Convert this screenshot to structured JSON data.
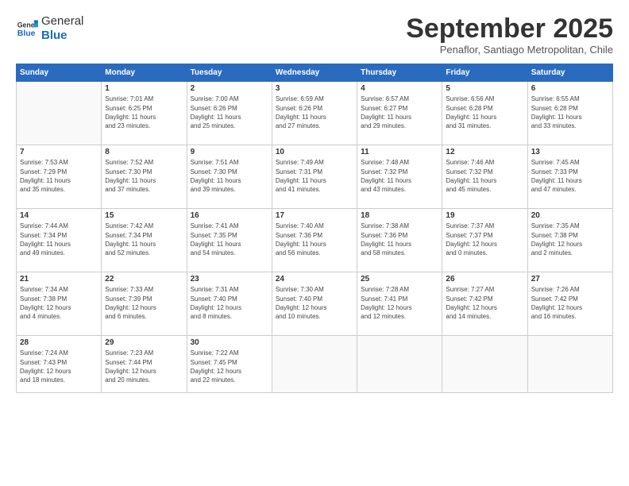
{
  "header": {
    "logo_general": "General",
    "logo_blue": "Blue",
    "month_title": "September 2025",
    "subtitle": "Penaflor, Santiago Metropolitan, Chile"
  },
  "days_of_week": [
    "Sunday",
    "Monday",
    "Tuesday",
    "Wednesday",
    "Thursday",
    "Friday",
    "Saturday"
  ],
  "weeks": [
    [
      {
        "day": "",
        "info": ""
      },
      {
        "day": "1",
        "info": "Sunrise: 7:01 AM\nSunset: 6:25 PM\nDaylight: 11 hours\nand 23 minutes."
      },
      {
        "day": "2",
        "info": "Sunrise: 7:00 AM\nSunset: 6:26 PM\nDaylight: 11 hours\nand 25 minutes."
      },
      {
        "day": "3",
        "info": "Sunrise: 6:59 AM\nSunset: 6:26 PM\nDaylight: 11 hours\nand 27 minutes."
      },
      {
        "day": "4",
        "info": "Sunrise: 6:57 AM\nSunset: 6:27 PM\nDaylight: 11 hours\nand 29 minutes."
      },
      {
        "day": "5",
        "info": "Sunrise: 6:56 AM\nSunset: 6:28 PM\nDaylight: 11 hours\nand 31 minutes."
      },
      {
        "day": "6",
        "info": "Sunrise: 6:55 AM\nSunset: 6:28 PM\nDaylight: 11 hours\nand 33 minutes."
      }
    ],
    [
      {
        "day": "7",
        "info": "Sunrise: 7:53 AM\nSunset: 7:29 PM\nDaylight: 11 hours\nand 35 minutes."
      },
      {
        "day": "8",
        "info": "Sunrise: 7:52 AM\nSunset: 7:30 PM\nDaylight: 11 hours\nand 37 minutes."
      },
      {
        "day": "9",
        "info": "Sunrise: 7:51 AM\nSunset: 7:30 PM\nDaylight: 11 hours\nand 39 minutes."
      },
      {
        "day": "10",
        "info": "Sunrise: 7:49 AM\nSunset: 7:31 PM\nDaylight: 11 hours\nand 41 minutes."
      },
      {
        "day": "11",
        "info": "Sunrise: 7:48 AM\nSunset: 7:32 PM\nDaylight: 11 hours\nand 43 minutes."
      },
      {
        "day": "12",
        "info": "Sunrise: 7:46 AM\nSunset: 7:32 PM\nDaylight: 11 hours\nand 45 minutes."
      },
      {
        "day": "13",
        "info": "Sunrise: 7:45 AM\nSunset: 7:33 PM\nDaylight: 11 hours\nand 47 minutes."
      }
    ],
    [
      {
        "day": "14",
        "info": "Sunrise: 7:44 AM\nSunset: 7:34 PM\nDaylight: 11 hours\nand 49 minutes."
      },
      {
        "day": "15",
        "info": "Sunrise: 7:42 AM\nSunset: 7:34 PM\nDaylight: 11 hours\nand 52 minutes."
      },
      {
        "day": "16",
        "info": "Sunrise: 7:41 AM\nSunset: 7:35 PM\nDaylight: 11 hours\nand 54 minutes."
      },
      {
        "day": "17",
        "info": "Sunrise: 7:40 AM\nSunset: 7:36 PM\nDaylight: 11 hours\nand 56 minutes."
      },
      {
        "day": "18",
        "info": "Sunrise: 7:38 AM\nSunset: 7:36 PM\nDaylight: 11 hours\nand 58 minutes."
      },
      {
        "day": "19",
        "info": "Sunrise: 7:37 AM\nSunset: 7:37 PM\nDaylight: 12 hours\nand 0 minutes."
      },
      {
        "day": "20",
        "info": "Sunrise: 7:35 AM\nSunset: 7:38 PM\nDaylight: 12 hours\nand 2 minutes."
      }
    ],
    [
      {
        "day": "21",
        "info": "Sunrise: 7:34 AM\nSunset: 7:38 PM\nDaylight: 12 hours\nand 4 minutes."
      },
      {
        "day": "22",
        "info": "Sunrise: 7:33 AM\nSunset: 7:39 PM\nDaylight: 12 hours\nand 6 minutes."
      },
      {
        "day": "23",
        "info": "Sunrise: 7:31 AM\nSunset: 7:40 PM\nDaylight: 12 hours\nand 8 minutes."
      },
      {
        "day": "24",
        "info": "Sunrise: 7:30 AM\nSunset: 7:40 PM\nDaylight: 12 hours\nand 10 minutes."
      },
      {
        "day": "25",
        "info": "Sunrise: 7:28 AM\nSunset: 7:41 PM\nDaylight: 12 hours\nand 12 minutes."
      },
      {
        "day": "26",
        "info": "Sunrise: 7:27 AM\nSunset: 7:42 PM\nDaylight: 12 hours\nand 14 minutes."
      },
      {
        "day": "27",
        "info": "Sunrise: 7:26 AM\nSunset: 7:42 PM\nDaylight: 12 hours\nand 16 minutes."
      }
    ],
    [
      {
        "day": "28",
        "info": "Sunrise: 7:24 AM\nSunset: 7:43 PM\nDaylight: 12 hours\nand 18 minutes."
      },
      {
        "day": "29",
        "info": "Sunrise: 7:23 AM\nSunset: 7:44 PM\nDaylight: 12 hours\nand 20 minutes."
      },
      {
        "day": "30",
        "info": "Sunrise: 7:22 AM\nSunset: 7:45 PM\nDaylight: 12 hours\nand 22 minutes."
      },
      {
        "day": "",
        "info": ""
      },
      {
        "day": "",
        "info": ""
      },
      {
        "day": "",
        "info": ""
      },
      {
        "day": "",
        "info": ""
      }
    ]
  ]
}
